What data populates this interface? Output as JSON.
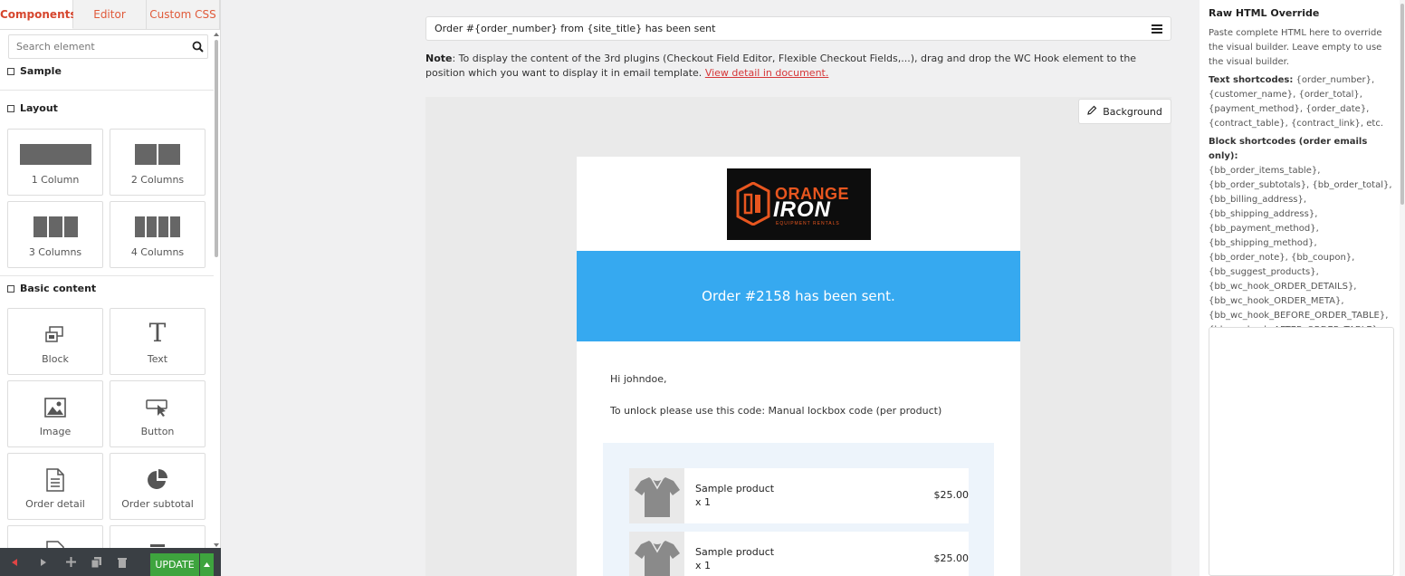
{
  "left_panel": {
    "tabs": [
      "Components",
      "Editor",
      "Custom CSS"
    ],
    "search_placeholder": "Search element",
    "sections": {
      "sample": "Sample",
      "layout": "Layout",
      "basic": "Basic content"
    },
    "layout_items": [
      "1 Column",
      "2 Columns",
      "3 Columns",
      "4 Columns"
    ],
    "basic_items": [
      "Block",
      "Text",
      "Image",
      "Button",
      "Order detail",
      "Order subtotal"
    ],
    "update_label": "UPDATE"
  },
  "editor": {
    "subject": "Order #{order_number} from {site_title} has been sent",
    "note_label": "Note",
    "note_text": ": To display the content of the 3rd plugins (Checkout Field Editor, Flexible Checkout Fields,...), drag and drop the WC Hook element to the position which you want to display it in email template.",
    "note_link": "View detail in document.",
    "background_label": "Background"
  },
  "email": {
    "logo_line1": "ORANGE",
    "logo_line2": "IRON",
    "logo_line3": "EQUIPMENT RENTALS",
    "banner": "Order #2158 has been sent.",
    "greeting": "Hi johndoe,",
    "unlock": "To unlock please use this code: Manual lockbox code (per product)",
    "items": [
      {
        "name": "Sample product",
        "qty": "x 1",
        "price": "$25.00"
      },
      {
        "name": "Sample product",
        "qty": "x 1",
        "price": "$25.00"
      }
    ]
  },
  "right_panel": {
    "title": "Raw HTML Override",
    "intro": "Paste complete HTML here to override the visual builder. Leave empty to use the visual builder.",
    "text_label": "Text shortcodes:",
    "text_codes": " {order_number}, {customer_name}, {order_total}, {payment_method}, {order_date}, {contract_table}, {contract_link}, etc.",
    "block_label": "Block shortcodes (order emails only):",
    "block_codes": "{bb_order_items_table}, {bb_order_subtotals}, {bb_order_total}, {bb_billing_address}, {bb_shipping_address}, {bb_payment_method}, {bb_shipping_method}, {bb_order_note}, {bb_coupon}, {bb_suggest_products}, {bb_wc_hook_ORDER_DETAILS}, {bb_wc_hook_ORDER_META}, {bb_wc_hook_BEFORE_ORDER_TABLE}, {bb_wc_hook_AFTER_ORDER_TABLE}",
    "raw_value": ""
  },
  "colors": {
    "accent": "#d6462e",
    "banner": "#36a9f0",
    "update": "#3ea43e",
    "toolbar": "#3a3f44"
  },
  "icons": [
    "search-icon",
    "hamburger-icon",
    "pencil-icon",
    "arrow-left-icon",
    "play-icon",
    "plus-icon",
    "copy-icon",
    "trash-icon",
    "caret-up-icon",
    "block-icon",
    "text-icon",
    "image-icon",
    "button-icon",
    "order-detail-icon",
    "order-subtotal-icon",
    "shirt-icon"
  ]
}
